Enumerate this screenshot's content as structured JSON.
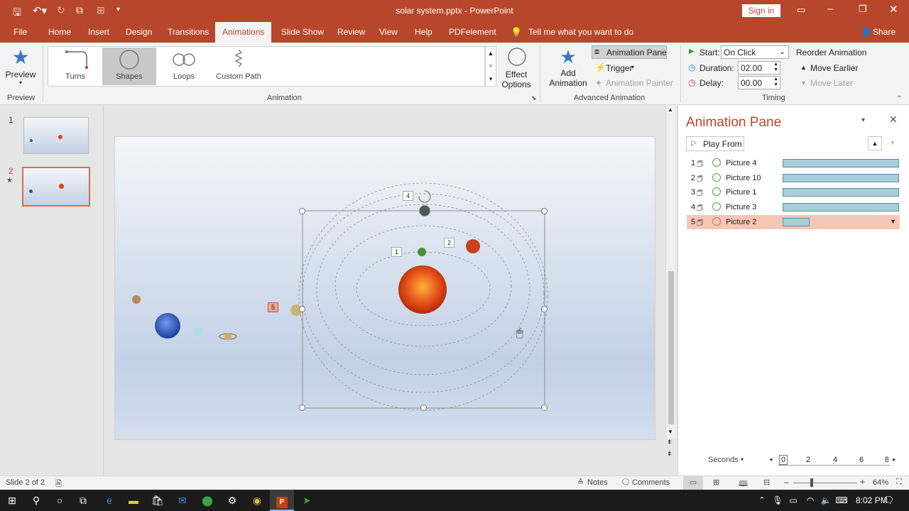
{
  "titlebar": {
    "title": "solar system.pptx - PowerPoint",
    "signin": "Sign in"
  },
  "tabs": [
    "File",
    "Home",
    "Insert",
    "Design",
    "Transitions",
    "Animations",
    "Slide Show",
    "Review",
    "View",
    "Help",
    "PDFelement"
  ],
  "active_tab": "Animations",
  "tellme": "Tell me what you want to do",
  "share": "Share",
  "ribbon": {
    "preview_label": "Preview",
    "preview_group": "Preview",
    "gallery": [
      "Turns",
      "Shapes",
      "Loops",
      "Custom Path"
    ],
    "effect_options": "Effect Options",
    "animation_group": "Animation",
    "add_animation": "Add Animation",
    "animation_pane": "Animation Pane",
    "trigger": "Trigger",
    "animation_painter": "Animation Painter",
    "advanced_group": "Advanced Animation",
    "start_label": "Start:",
    "start_value": "On Click",
    "duration_label": "Duration:",
    "duration_value": "02.00",
    "delay_label": "Delay:",
    "delay_value": "00.00",
    "reorder": "Reorder Animation",
    "move_earlier": "Move Earlier",
    "move_later": "Move Later",
    "timing_group": "Timing"
  },
  "slides": [
    {
      "num": "1",
      "star": ""
    },
    {
      "num": "2",
      "star": "★"
    }
  ],
  "slide_tags": [
    "4",
    "1",
    "2",
    "5"
  ],
  "pane": {
    "title": "Animation Pane",
    "play_from": "Play From",
    "items": [
      {
        "num": "1",
        "name": "Picture 4",
        "bar": 1.0
      },
      {
        "num": "2",
        "name": "Picture 10",
        "bar": 1.0
      },
      {
        "num": "3",
        "name": "Picture 1",
        "bar": 1.0
      },
      {
        "num": "4",
        "name": "Picture 3",
        "bar": 1.0
      },
      {
        "num": "5",
        "name": "Picture 2",
        "bar": 0.23
      }
    ],
    "seconds": "Seconds",
    "ticks": [
      "0",
      "2",
      "4",
      "6",
      "8"
    ]
  },
  "status": {
    "slide_info": "Slide 2 of 2",
    "notes": "Notes",
    "comments": "Comments",
    "zoom": "64%"
  },
  "taskbar": {
    "time": "8:02 PM"
  },
  "colors": {
    "accent": "#b7472a",
    "selected_row": "#f6c6b5",
    "bar_fill": "#a8cedb"
  }
}
